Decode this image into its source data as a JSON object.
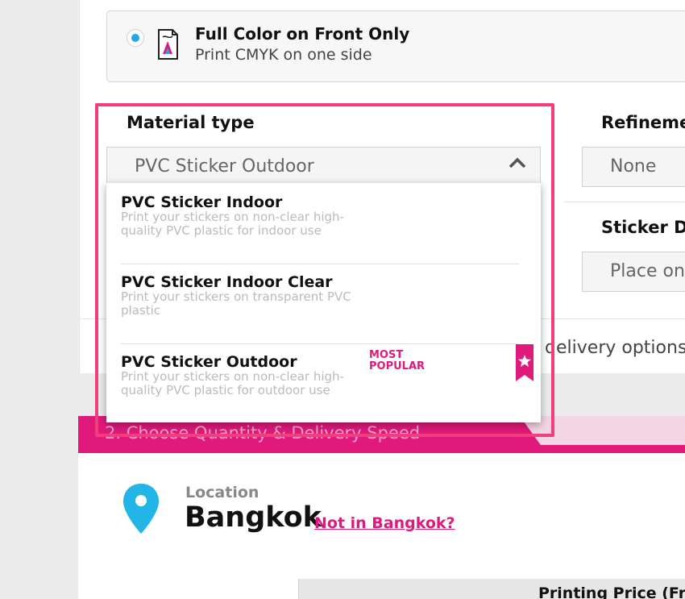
{
  "print_option": {
    "title": "Full Color on Front Only",
    "subtitle": "Print CMYK on one side",
    "selected": true
  },
  "material": {
    "label": "Material type",
    "selected_value": "PVC Sticker Outdoor",
    "options": [
      {
        "title": "PVC Sticker Indoor",
        "description": "Print your stickers on non-clear high-quality PVC plastic for indoor use"
      },
      {
        "title": "PVC Sticker Indoor Clear",
        "description": "Print your stickers on transparent PVC plastic"
      },
      {
        "title": "PVC Sticker Outdoor",
        "description": "Print your stickers on non-clear high-quality PVC plastic for outdoor use",
        "badge": "MOST POPULAR"
      }
    ]
  },
  "refinement": {
    "label": "Refineme",
    "value": "None"
  },
  "sticker_delivery": {
    "label": "Sticker De",
    "value": "Place on"
  },
  "delivery_options_text": "r delivery options",
  "section2": {
    "title": "2. Choose Quantity & Delivery Speed"
  },
  "location": {
    "label": "Location",
    "city": "Bangkok",
    "link": "Not in Bangkok?"
  },
  "price_table": {
    "header": "Printing Price (Free"
  },
  "colors": {
    "accent": "#e01a7c",
    "radio": "#22a7e0",
    "highlight": "#f23e7d"
  },
  "icons": [
    "print-sheet-icon",
    "chevron-up-icon",
    "location-pin-icon",
    "star-ribbon-icon"
  ]
}
